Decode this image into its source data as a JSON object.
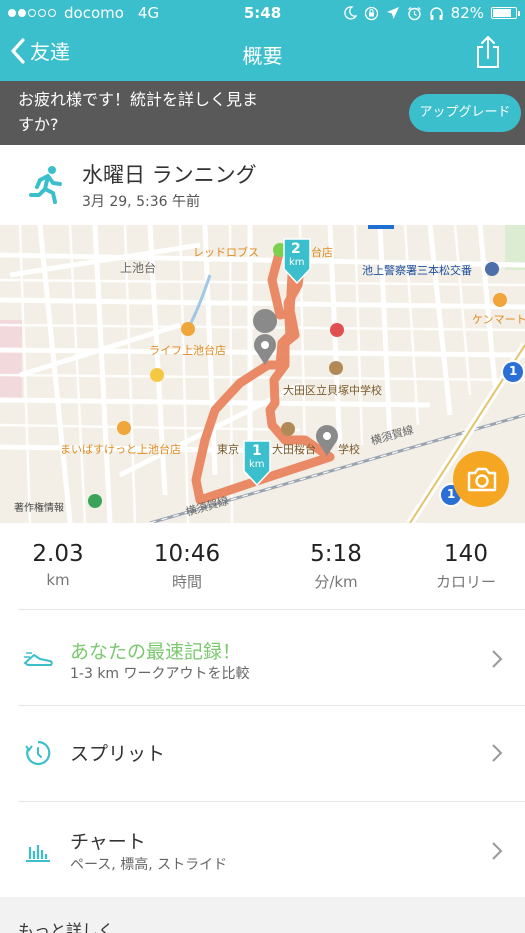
{
  "status_bar": {
    "carrier": "docomo",
    "network": "4G",
    "time": "5:48",
    "battery": "82%",
    "battery_level": 0.82,
    "signal_bars_filled": 2,
    "signal_bars_total": 5
  },
  "nav": {
    "back_label": "友達",
    "title": "概要"
  },
  "banner": {
    "message": "お疲れ様です！統計を詳しく見ますか?",
    "upgrade_label": "アップグレード"
  },
  "activity": {
    "name": "水曜日 ランニング",
    "date": "3月 29, 5:36 午前"
  },
  "map": {
    "labels": {
      "kamiikedai": "上池台",
      "red_lobster": "レッドロブス",
      "red_lobster_tail": "台店",
      "police": "池上警察署三本松交番",
      "kenmart": "ケンマート",
      "life": "ライフ上池台店",
      "school": "大田区立貝塚中学校",
      "maibasket": "まいばすけっと上池台店",
      "tokyo": "東京",
      "school2": "大田桜台",
      "school2_tail": "学校",
      "yokosuka1": "横須賀線",
      "yokosuka2": "横須賀線",
      "copyright": "著作権情報"
    },
    "km_markers": [
      {
        "number": "2",
        "unit": "km"
      },
      {
        "number": "1",
        "unit": "km"
      }
    ],
    "route_badge": "1"
  },
  "stats": [
    {
      "value": "2.03",
      "unit": "km"
    },
    {
      "value": "10:46",
      "unit": "時間"
    },
    {
      "value": "5:18",
      "unit": "分/km"
    },
    {
      "value": "140",
      "unit": "カロリー"
    }
  ],
  "rows": {
    "best": {
      "title": "あなたの最速記録！",
      "subtitle": "1-3 km ワークアウトを比較"
    },
    "splits": {
      "title": "スプリット"
    },
    "chart": {
      "title": "チャート",
      "subtitle": "ペース, 標高, ストライド"
    }
  },
  "more_label": "もっと詳しく",
  "colors": {
    "accent": "#3bbfcd",
    "route": "#e87d57",
    "camera": "#f5a623",
    "best_green": "#7bc96f"
  }
}
